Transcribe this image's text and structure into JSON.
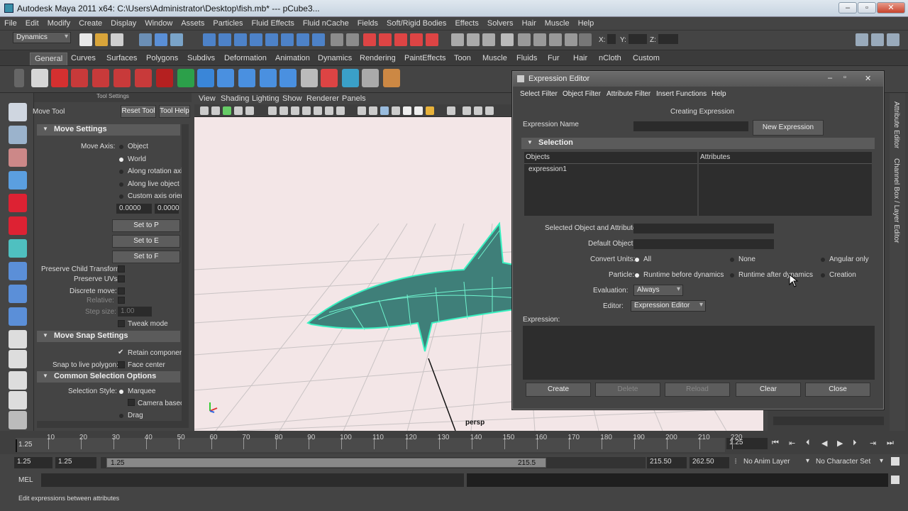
{
  "window": {
    "title": "Autodesk Maya 2011 x64: C:\\Users\\Administrator\\Desktop\\fish.mb*   ---   pCube3..."
  },
  "menu": [
    "File",
    "Edit",
    "Modify",
    "Create",
    "Display",
    "Window",
    "Assets",
    "Particles",
    "Fluid Effects",
    "Fluid nCache",
    "Fields",
    "Soft/Rigid Bodies",
    "Effects",
    "Solvers",
    "Hair",
    "Muscle",
    "Help"
  ],
  "status": {
    "mode": "Dynamics",
    "x_label": "X:",
    "y_label": "Y:",
    "z_label": "Z:"
  },
  "shelf_tabs": [
    "General",
    "Curves",
    "Surfaces",
    "Polygons",
    "Subdivs",
    "Deformation",
    "Animation",
    "Dynamics",
    "Rendering",
    "PaintEffects",
    "Toon",
    "Muscle",
    "Fluids",
    "Fur",
    "Hair",
    "nCloth",
    "Custom"
  ],
  "tool_settings": {
    "header": "Tool Settings",
    "tool_name": "Move Tool",
    "reset_btn": "Reset Tool",
    "help_btn": "Tool Help",
    "move_settings": "Move Settings",
    "move_axis_label": "Move Axis:",
    "axis_options": [
      "Object",
      "World",
      "Along rotation axi",
      "Along live object a",
      "Custom axis orien"
    ],
    "custom_values": [
      "0.0000",
      "0.0000"
    ],
    "set_buttons": [
      "Set to P",
      "Set to E",
      "Set to F"
    ],
    "preserve_child": "Preserve Child Transform",
    "preserve_uvs": "Preserve UVs",
    "discrete_move": "Discrete move:",
    "relative": "Relative:",
    "step_size": "Step size:",
    "step_value": "1.00",
    "tweak_mode": "Tweak mode",
    "snap_settings": "Move Snap Settings",
    "retain": "Retain componen",
    "snap_live": "Snap to live polygon:",
    "face_center": "Face center",
    "common_sel": "Common Selection Options",
    "sel_style": "Selection Style:",
    "marquee": "Marquee",
    "camera_based": "Camera basec",
    "drag": "Drag"
  },
  "panel_menu": [
    "View",
    "Shading",
    "Lighting",
    "Show",
    "Renderer",
    "Panels"
  ],
  "viewport": {
    "camera": "persp"
  },
  "side_tabs": [
    "Attribute Editor",
    "Channel Box / Layer Editor"
  ],
  "expression_editor": {
    "title": "Expression Editor",
    "menu": [
      "Select Filter",
      "Object Filter",
      "Attribute Filter",
      "Insert Functions",
      "Help"
    ],
    "mode": "Creating Expression",
    "name_label": "Expression Name",
    "name_value": "",
    "new_btn": "New Expression",
    "selection": "Selection",
    "objects_header": "Objects",
    "attributes_header": "Attributes",
    "objects": [
      "expression1"
    ],
    "selected_obj_label": "Selected Object and Attribute:",
    "default_obj_label": "Default Object:",
    "convert_label": "Convert Units:",
    "convert_opts": [
      "All",
      "None",
      "Angular only"
    ],
    "particle_label": "Particle:",
    "particle_opts": [
      "Runtime before dynamics",
      "Runtime after dynamics",
      "Creation"
    ],
    "evaluation_label": "Evaluation:",
    "evaluation_value": "Always",
    "editor_label": "Editor:",
    "editor_value": "Expression Editor",
    "expression_label": "Expression:",
    "buttons": [
      "Create",
      "Delete",
      "Reload",
      "Clear",
      "Close"
    ]
  },
  "timeline": {
    "ticks": [
      "10",
      "20",
      "30",
      "40",
      "50",
      "60",
      "70",
      "80",
      "90",
      "100",
      "110",
      "120",
      "130",
      "140",
      "150",
      "160",
      "170",
      "180",
      "190",
      "200",
      "210",
      "220"
    ],
    "start_marker": "1.25",
    "current": "1.25"
  },
  "range": {
    "start": "1.25",
    "start2": "1.25",
    "slider_start": "1.25",
    "slider_end": "215.5",
    "end": "215.50",
    "end2": "262.50",
    "anim_layer": "No Anim Layer",
    "char_set": "No Character Set"
  },
  "command": {
    "lang": "MEL"
  },
  "help_line": "Edit expressions between attributes"
}
